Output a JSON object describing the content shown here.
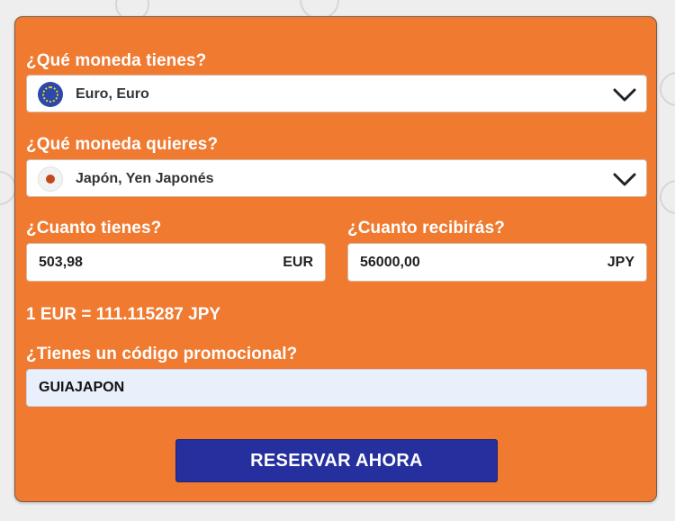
{
  "colors": {
    "card_bg": "#ef7a30",
    "button_bg": "#25309e",
    "promo_bg": "#e9f0fc"
  },
  "have_currency": {
    "label": "¿Qué moneda tienes?",
    "selected": "Euro, Euro",
    "flag_icon": "eu-flag-icon"
  },
  "want_currency": {
    "label": "¿Qué moneda quieres?",
    "selected": "Japón, Yen Japonés",
    "flag_icon": "japan-flag-icon"
  },
  "amount_have": {
    "label": "¿Cuanto tienes?",
    "value": "503,98",
    "currency": "EUR"
  },
  "amount_receive": {
    "label": "¿Cuanto recibirás?",
    "value": "56000,00",
    "currency": "JPY"
  },
  "exchange_rate": "1 EUR = 111.115287 JPY",
  "promo": {
    "label": "¿Tienes un código promocional?",
    "value": "GUIAJAPON"
  },
  "submit_label": "RESERVAR AHORA"
}
